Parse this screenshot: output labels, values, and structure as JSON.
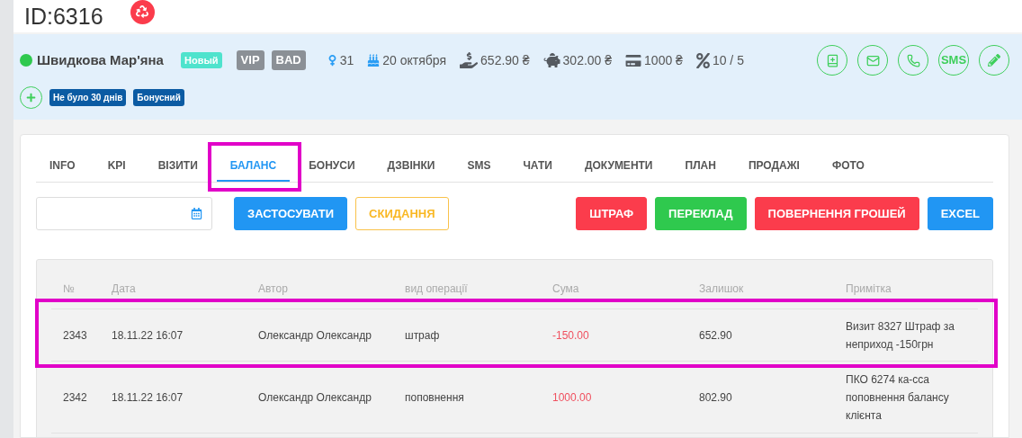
{
  "header": {
    "title": "ID:6316"
  },
  "client": {
    "name": "Швидкова Мар'яна",
    "online": true,
    "badges": [
      {
        "text": "Новый",
        "color": "#4fe3cd"
      },
      {
        "text": "VIP",
        "color": "#8b9096"
      },
      {
        "text": "BAD",
        "color": "#8b9096"
      }
    ],
    "stats": [
      {
        "kind": "gender",
        "text": "31"
      },
      {
        "kind": "birthday",
        "text": "20 октября"
      },
      {
        "kind": "balance",
        "text": "652.90 ₴"
      },
      {
        "kind": "savings",
        "text": "302.00 ₴"
      },
      {
        "kind": "card",
        "text": "1000 ₴"
      },
      {
        "kind": "percent",
        "text": "10 / 5"
      }
    ],
    "actions": [
      {
        "kind": "book"
      },
      {
        "kind": "mail"
      },
      {
        "kind": "phone"
      },
      {
        "kind": "text",
        "text": "SMS"
      },
      {
        "kind": "edit"
      }
    ],
    "tags": [
      "Не було 30 днів",
      "Бонусний"
    ]
  },
  "tabs": [
    {
      "label": "INFO",
      "selected": false,
      "highlighted": false
    },
    {
      "label": "KPI",
      "selected": false,
      "highlighted": false
    },
    {
      "label": "ВІЗИТИ",
      "selected": false,
      "highlighted": false
    },
    {
      "label": "БАЛАНС",
      "selected": true,
      "highlighted": true
    },
    {
      "label": "БОНУСИ",
      "selected": false,
      "highlighted": false
    },
    {
      "label": "ДЗВІНКИ",
      "selected": false,
      "highlighted": false
    },
    {
      "label": "SMS",
      "selected": false,
      "highlighted": false
    },
    {
      "label": "ЧАТИ",
      "selected": false,
      "highlighted": false
    },
    {
      "label": "ДОКУМЕНТИ",
      "selected": false,
      "highlighted": false
    },
    {
      "label": "ПЛАН",
      "selected": false,
      "highlighted": false
    },
    {
      "label": "ПРОДАЖІ",
      "selected": false,
      "highlighted": false
    },
    {
      "label": "ФОТО",
      "selected": false,
      "highlighted": false
    }
  ],
  "filter_buttons": [
    {
      "text": "ЗАСТОСУВАТИ",
      "kind": "primary"
    },
    {
      "text": "СКИДАННЯ",
      "kind": "warning-outline"
    }
  ],
  "action_buttons": [
    {
      "text": "ШТРАФ",
      "kind": "danger"
    },
    {
      "text": "ПЕРЕКЛАД",
      "kind": "success"
    },
    {
      "text": "ПОВЕРНЕННЯ ГРОШЕЙ",
      "kind": "danger"
    },
    {
      "text": "EXCEL",
      "kind": "primary"
    }
  ],
  "table": {
    "columns": [
      "№",
      "Дата",
      "Автор",
      "вид операції",
      "Сума",
      "Залишок",
      "Примітка"
    ],
    "rows": [
      {
        "cells": [
          "2343",
          "18.11.22 16:07",
          "Олександр Олександр",
          "штраф",
          "-150.00",
          "652.90",
          "Визит 8327 Штраф за неприход -150грн"
        ],
        "highlighted": true
      },
      {
        "cells": [
          "2342",
          "18.11.22 16:07",
          "Олександр Олександр",
          "поповнення",
          "1000.00",
          "802.90",
          "ПКО 6274 ка-сса поповнення балансу клієнта"
        ],
        "highlighted": false
      }
    ]
  }
}
